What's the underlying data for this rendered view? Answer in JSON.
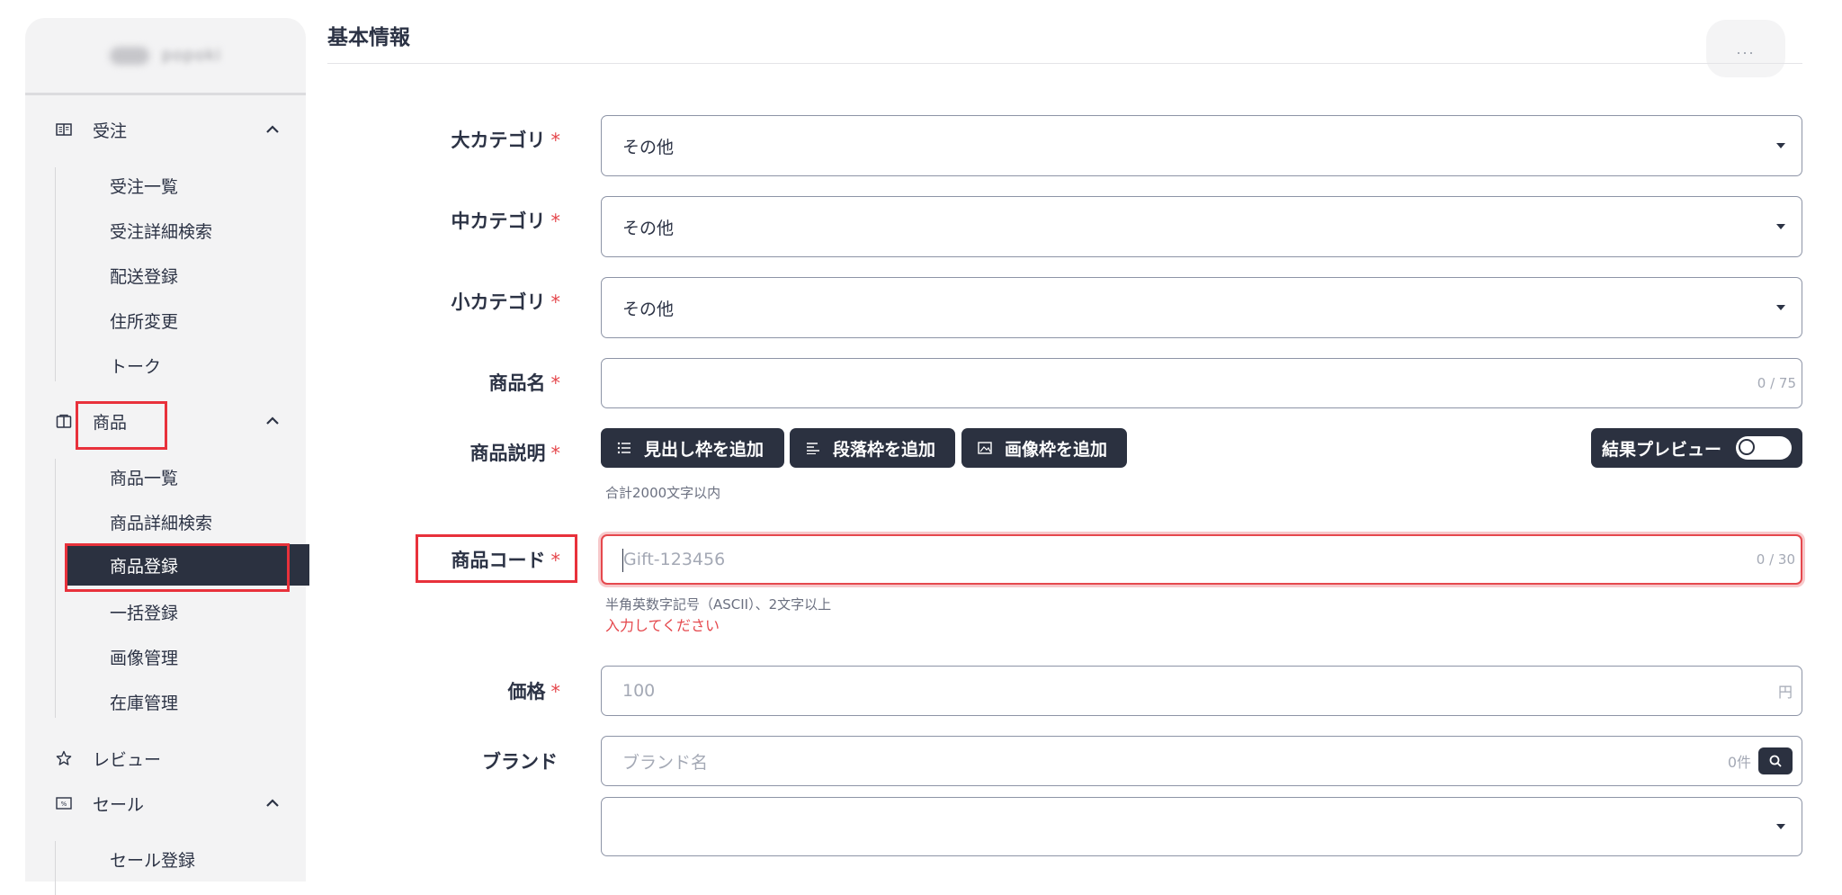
{
  "sidebar": {
    "user_name": "popoki",
    "groups": [
      {
        "label": "受注",
        "icon": "book-icon",
        "items": [
          "受注一覧",
          "受注詳細検索",
          "配送登録",
          "住所変更",
          "トーク"
        ]
      },
      {
        "label": "商品",
        "icon": "box-icon",
        "items": [
          "商品一覧",
          "商品詳細検索",
          "商品登録",
          "一括登録",
          "画像管理",
          "在庫管理"
        ],
        "active_item": "商品登録"
      },
      {
        "label": "レビュー",
        "icon": "star-icon"
      },
      {
        "label": "セール",
        "icon": "sale-icon",
        "items": [
          "セール登録"
        ]
      }
    ]
  },
  "header": {
    "title": "基本情報",
    "more_label": "..."
  },
  "form": {
    "category_large": {
      "label": "大カテゴリ",
      "value": "その他"
    },
    "category_middle": {
      "label": "中カテゴリ",
      "value": "その他"
    },
    "category_small": {
      "label": "小カテゴリ",
      "value": "その他"
    },
    "product_name": {
      "label": "商品名",
      "value": "",
      "counter": "0 / 75"
    },
    "description": {
      "label": "商品説明",
      "buttons": [
        "見出し枠を追加",
        "段落枠を追加",
        "画像枠を追加"
      ],
      "preview_label": "結果プレビュー",
      "preview_on": false,
      "help": "合計2000文字以内"
    },
    "product_code": {
      "label": "商品コード",
      "placeholder": "Gift-123456",
      "counter": "0 / 30",
      "help": "半角英数字記号（ASCII）、2文字以上",
      "error": "入力してください"
    },
    "price": {
      "label": "価格",
      "placeholder": "100",
      "unit": "円"
    },
    "brand": {
      "label": "ブランド",
      "placeholder": "ブランド名",
      "count": "0件",
      "select_value": ""
    },
    "required_mark": "*"
  },
  "colors": {
    "dark": "#2b3140",
    "accent_error": "#e5484d",
    "highlight": "#e8313b",
    "sidebar_bg": "#f3f3f4"
  }
}
